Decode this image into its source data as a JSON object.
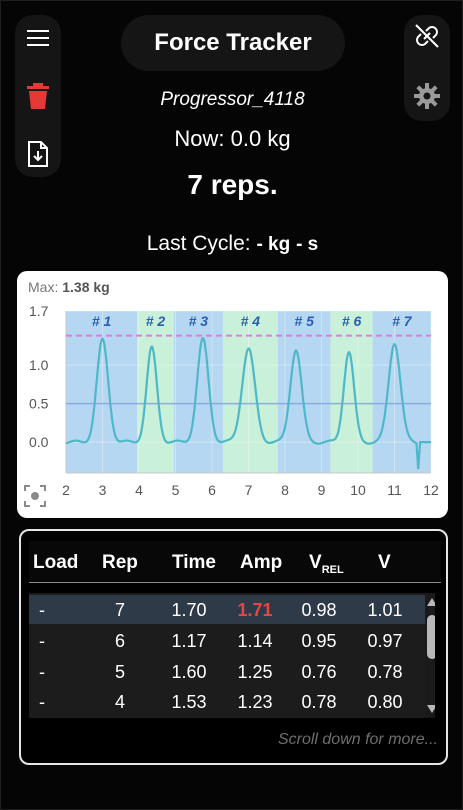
{
  "header": {
    "title": "Force Tracker",
    "device_name": "Progressor_4118",
    "now_label": "Now: 0.0 kg",
    "reps_label": "7 reps.",
    "last_cycle_label": "Last Cycle:",
    "last_cycle_kg": "- kg",
    "last_cycle_s": "- s"
  },
  "icons": {
    "menu": "menu-icon",
    "delete": "trash-icon",
    "download": "download-icon",
    "disconnect": "link-off-icon",
    "settings": "gear-icon",
    "chart_reset": "focus-icon"
  },
  "colors": {
    "accent_delete": "#e53935",
    "highlight_amp": "#e84545",
    "blue_region": "#b6d7f2",
    "green_region": "#c9f0d8",
    "trace": "#4fb8c8",
    "max_line": "#e07be0"
  },
  "chart_data": {
    "type": "line",
    "max_label": "Max:",
    "max_value": "1.38 kg",
    "max_line_value": 1.38,
    "threshold_value": 0.5,
    "xlim": [
      2,
      12
    ],
    "ylim": [
      -0.4,
      1.7
    ],
    "x_ticks": [
      2,
      3,
      4,
      5,
      6,
      7,
      8,
      9,
      10,
      11,
      12
    ],
    "y_ticks": [
      0.0,
      0.5,
      1.0,
      1.7
    ],
    "y_tick_labels": [
      "0.0",
      "0.5",
      "1.0",
      "1.7"
    ],
    "reps": [
      {
        "label": "# 1",
        "start": 2.0,
        "end": 3.95,
        "color": "blue"
      },
      {
        "label": "# 2",
        "start": 3.95,
        "end": 4.95,
        "color": "green"
      },
      {
        "label": "# 3",
        "start": 4.95,
        "end": 6.3,
        "color": "blue"
      },
      {
        "label": "# 4",
        "start": 6.3,
        "end": 7.8,
        "color": "green"
      },
      {
        "label": "# 5",
        "start": 7.8,
        "end": 9.25,
        "color": "blue"
      },
      {
        "label": "# 6",
        "start": 9.25,
        "end": 10.4,
        "color": "green"
      },
      {
        "label": "# 7",
        "start": 10.4,
        "end": 12.0,
        "color": "blue"
      }
    ],
    "peaks": [
      {
        "x": 3.0,
        "y": 1.32,
        "w": 0.22
      },
      {
        "x": 4.35,
        "y": 1.22,
        "w": 0.2
      },
      {
        "x": 5.75,
        "y": 1.33,
        "w": 0.22
      },
      {
        "x": 7.0,
        "y": 1.21,
        "w": 0.25
      },
      {
        "x": 8.3,
        "y": 1.2,
        "w": 0.22
      },
      {
        "x": 9.75,
        "y": 1.17,
        "w": 0.2
      },
      {
        "x": 11.0,
        "y": 1.29,
        "w": 0.23
      }
    ],
    "baseline": 0.0
  },
  "table": {
    "columns": [
      "Load",
      "Rep",
      "Time",
      "Amp",
      "V",
      "V"
    ],
    "v_rel_sub": "REL",
    "rows": [
      [
        "-",
        "7",
        "1.70",
        "1.71",
        "0.98",
        "1.01"
      ],
      [
        "-",
        "6",
        "1.17",
        "1.14",
        "0.95",
        "0.97"
      ],
      [
        "-",
        "5",
        "1.60",
        "1.25",
        "0.76",
        "0.78"
      ],
      [
        "-",
        "4",
        "1.53",
        "1.23",
        "0.78",
        "0.80"
      ]
    ],
    "scroll_hint": "Scroll down for more..."
  }
}
